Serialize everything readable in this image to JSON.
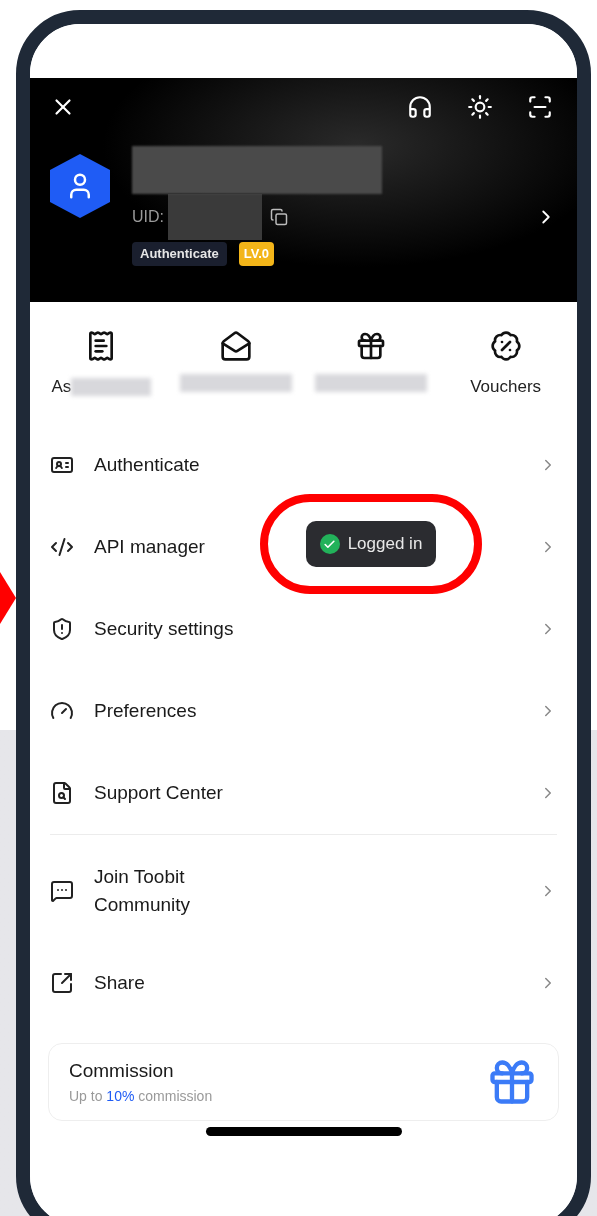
{
  "header": {
    "uid_label": "UID:",
    "badges": [
      {
        "label": "Authenticate",
        "kind": "status"
      },
      {
        "label": "LV.0",
        "kind": "level"
      }
    ]
  },
  "quick_actions": [
    {
      "label": "As",
      "blurred": true
    },
    {
      "blurred": true
    },
    {
      "blurred": true
    },
    {
      "label": "Vouchers",
      "blurred": false
    }
  ],
  "menu_sections": [
    {
      "items": [
        {
          "label": "Authenticate"
        },
        {
          "label": "API manager"
        },
        {
          "label": "Security settings"
        },
        {
          "label": "Preferences"
        },
        {
          "label": "Support Center"
        }
      ]
    },
    {
      "items": [
        {
          "label": "Join Toobit\nCommunity"
        },
        {
          "label": "Share"
        }
      ]
    }
  ],
  "toast": {
    "text": "Logged in"
  },
  "promo_card": {
    "title": "Commission",
    "subtitle": "Up to **10%** commission"
  }
}
